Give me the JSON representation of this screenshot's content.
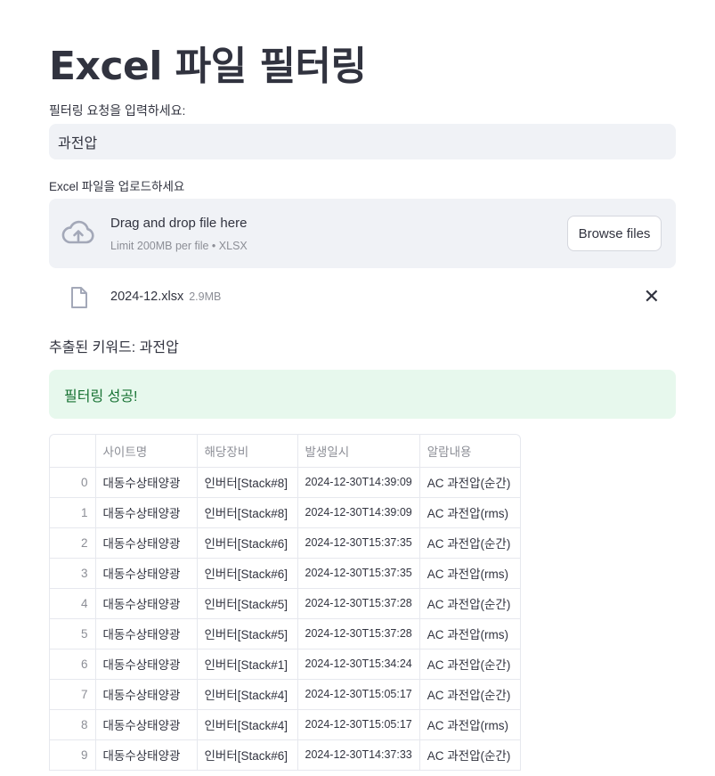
{
  "title": "Excel 파일 필터링",
  "filter": {
    "label": "필터링 요청을 입력하세요:",
    "value": "과전압"
  },
  "upload": {
    "label": "Excel 파일을 업로드하세요",
    "drag_text": "Drag and drop file here",
    "limit_text": "Limit 200MB per file • XLSX",
    "browse_label": "Browse files",
    "file_name": "2024-12.xlsx",
    "file_size": "2.9MB"
  },
  "keyword_text": "추출된 키워드: 과전압",
  "success_text": "필터링 성공!",
  "table": {
    "columns": [
      "",
      "사이트명",
      "해당장비",
      "발생일시",
      "알람내용"
    ],
    "rows": [
      [
        "0",
        "대동수상태양광",
        "인버터[Stack#8]",
        "2024-12-30T14:39:09",
        "AC 과전압(순간)"
      ],
      [
        "1",
        "대동수상태양광",
        "인버터[Stack#8]",
        "2024-12-30T14:39:09",
        "AC 과전압(rms)"
      ],
      [
        "2",
        "대동수상태양광",
        "인버터[Stack#6]",
        "2024-12-30T15:37:35",
        "AC 과전압(순간)"
      ],
      [
        "3",
        "대동수상태양광",
        "인버터[Stack#6]",
        "2024-12-30T15:37:35",
        "AC 과전압(rms)"
      ],
      [
        "4",
        "대동수상태양광",
        "인버터[Stack#5]",
        "2024-12-30T15:37:28",
        "AC 과전압(순간)"
      ],
      [
        "5",
        "대동수상태양광",
        "인버터[Stack#5]",
        "2024-12-30T15:37:28",
        "AC 과전압(rms)"
      ],
      [
        "6",
        "대동수상태양광",
        "인버터[Stack#1]",
        "2024-12-30T15:34:24",
        "AC 과전압(순간)"
      ],
      [
        "7",
        "대동수상태양광",
        "인버터[Stack#4]",
        "2024-12-30T15:05:17",
        "AC 과전압(순간)"
      ],
      [
        "8",
        "대동수상태양광",
        "인버터[Stack#4]",
        "2024-12-30T15:05:17",
        "AC 과전압(rms)"
      ],
      [
        "9",
        "대동수상태양광",
        "인버터[Stack#6]",
        "2024-12-30T14:37:33",
        "AC 과전압(순간)"
      ]
    ]
  },
  "colors": {
    "input_bg": "#f0f2f6",
    "success_bg": "#e7f8ed",
    "success_text": "#177233",
    "icon": "#a3a8b8"
  },
  "icons": {
    "upload": "cloud-upload-icon",
    "file": "file-icon",
    "remove": "close-icon"
  }
}
